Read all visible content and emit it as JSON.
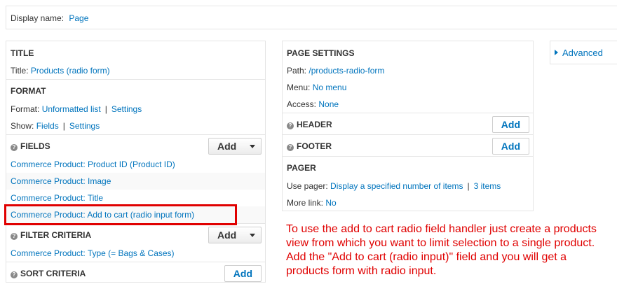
{
  "display_name": {
    "label": "Display name:",
    "value": "Page"
  },
  "col1": {
    "title_section": {
      "heading": "TITLE",
      "label": "Title:",
      "value": "Products (radio form)"
    },
    "format_section": {
      "heading": "FORMAT",
      "format_label": "Format:",
      "format_value": "Unformatted list",
      "format_settings": "Settings",
      "show_label": "Show:",
      "show_value": "Fields",
      "show_settings": "Settings"
    },
    "fields_section": {
      "heading": "FIELDS",
      "add_label": "Add",
      "items": [
        "Commerce Product: Product ID (Product ID)",
        "Commerce Product: Image",
        "Commerce Product: Title",
        "Commerce Product: Add to cart (radio input form)"
      ]
    },
    "filter_section": {
      "heading": "FILTER CRITERIA",
      "add_label": "Add",
      "items": [
        "Commerce Product: Type (= Bags & Cases)"
      ]
    },
    "sort_section": {
      "heading": "SORT CRITERIA",
      "add_label": "Add"
    }
  },
  "col2": {
    "page_settings": {
      "heading": "PAGE SETTINGS",
      "path_label": "Path:",
      "path_value": "/products-radio-form",
      "menu_label": "Menu:",
      "menu_value": "No menu",
      "access_label": "Access:",
      "access_value": "None"
    },
    "header_section": {
      "heading": "HEADER",
      "add_label": "Add"
    },
    "footer_section": {
      "heading": "FOOTER",
      "add_label": "Add"
    },
    "pager_section": {
      "heading": "PAGER",
      "use_label": "Use pager:",
      "use_value": "Display a specified number of items",
      "use_items": "3 items",
      "more_label": "More link:",
      "more_value": "No"
    }
  },
  "col3": {
    "advanced": "Advanced"
  },
  "annotation": "To use the add to cart radio field handler just create a products view from which you want to limit selection to a single product. Add the \"Add to cart (radio input)\" field and you will get a products form with radio input.",
  "colors": {
    "link": "#0074bd",
    "annotation": "#e00000"
  }
}
